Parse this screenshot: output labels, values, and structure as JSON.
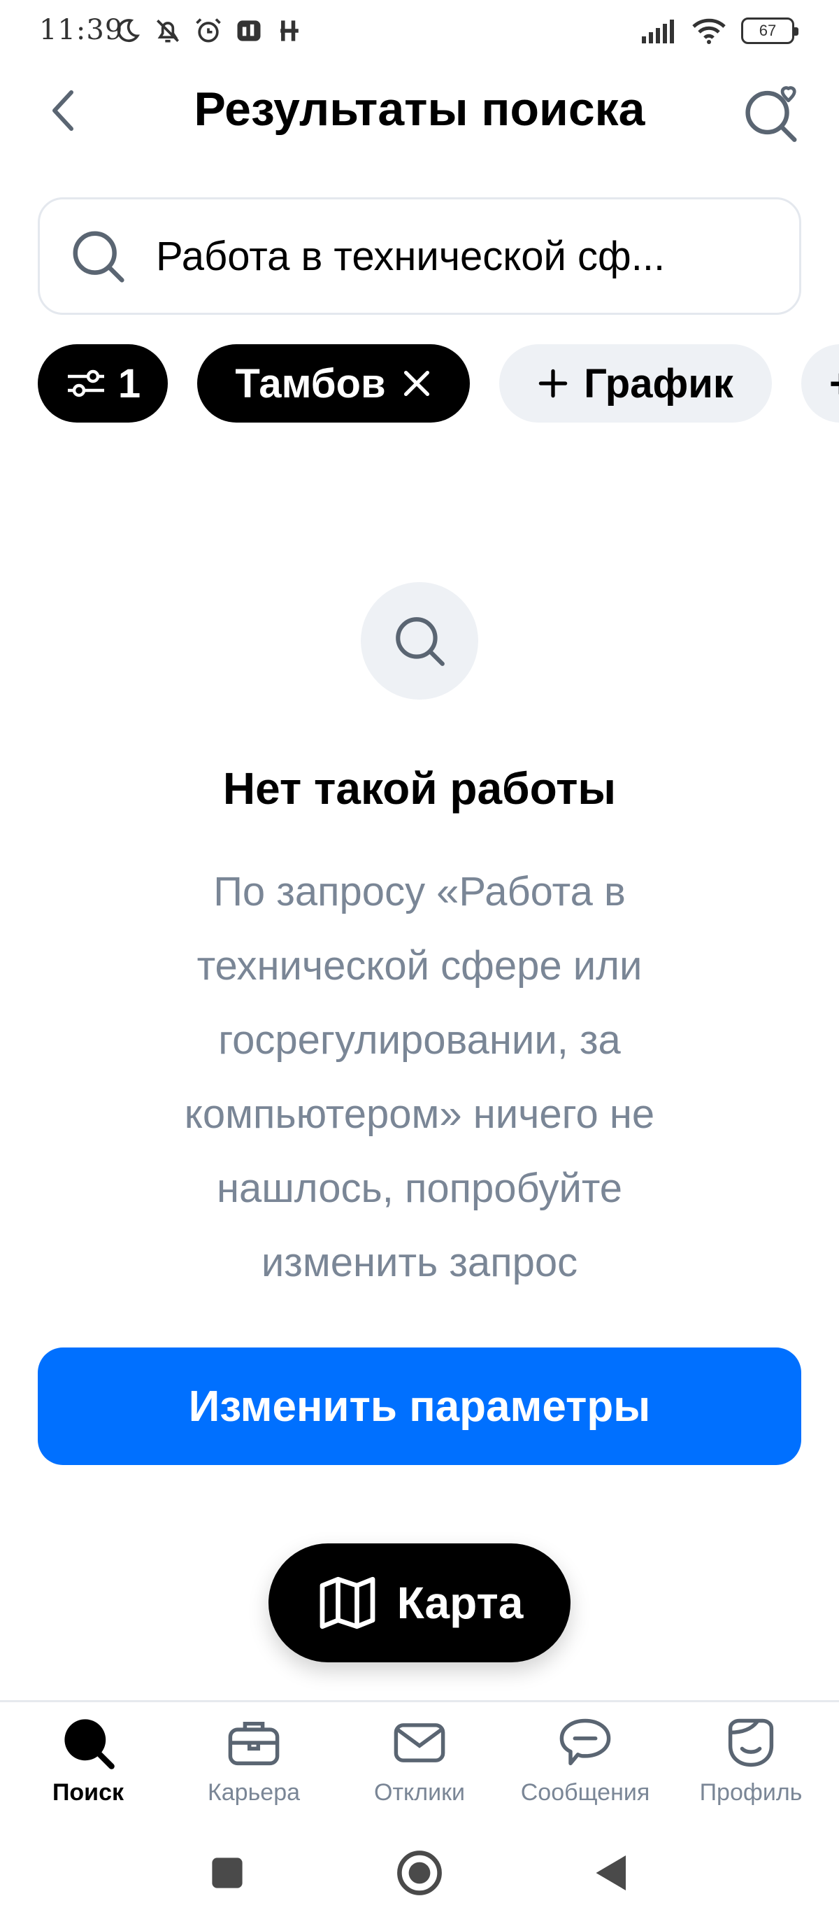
{
  "status_bar": {
    "time": "11:39",
    "battery": "67",
    "left_icons": [
      "moon-icon",
      "bell-off-icon",
      "alarm-icon",
      "app-icon",
      "h-icon"
    ],
    "right_icons": [
      "signal-icon",
      "wifi-icon",
      "battery-icon"
    ]
  },
  "header": {
    "title": "Результаты поиска",
    "back_icon": "chevron-left-icon",
    "favorite_icon": "search-heart-icon"
  },
  "search": {
    "value": "Работа в технической сф..."
  },
  "chips": {
    "filter_count": "1",
    "city": "Тамбов",
    "schedule": "График",
    "more": "+"
  },
  "empty_state": {
    "title": "Нет такой работы",
    "lines": [
      "По запросу «Работа в",
      "технической сфере или",
      "госрегулировании, за",
      "компьютером» ничего не",
      "нашлось, попробуйте",
      "изменить запрос"
    ]
  },
  "actions": {
    "change_params": "Изменить параметры",
    "map": "Карта"
  },
  "bottom_nav": {
    "items": [
      {
        "label": "Поиск",
        "icon": "search-icon",
        "active": true
      },
      {
        "label": "Карьера",
        "icon": "briefcase-icon",
        "active": false
      },
      {
        "label": "Отклики",
        "icon": "envelope-icon",
        "active": false
      },
      {
        "label": "Сообщения",
        "icon": "chat-bubble-icon",
        "active": false
      },
      {
        "label": "Профиль",
        "icon": "profile-face-icon",
        "active": false
      }
    ]
  },
  "colors": {
    "accent": "#0070ff",
    "chip_dark": "#000000",
    "chip_light": "#eef1f5",
    "muted_text": "#7a8696"
  }
}
